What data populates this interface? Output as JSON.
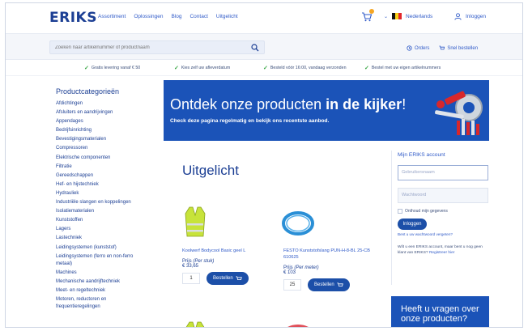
{
  "header": {
    "logo": "ERIKS",
    "nav": [
      "Assortiment",
      "Oplossingen",
      "Blog",
      "Contact",
      "Uitgelicht"
    ],
    "language": "Nederlands",
    "login": "Inloggen"
  },
  "search": {
    "placeholder": "Zoeken naar artikelnummer of productnaam",
    "orders_link": "Orders",
    "quick_order_link": "Snel bestellen"
  },
  "usps": [
    "Gratis levering vanaf € 50",
    "Kies zelf uw afleverdatum",
    "Besteld vóór 16:00, vandaag verzonden",
    "Bestel met uw eigen artikelnummers"
  ],
  "sidebar": {
    "title": "Productcategorieën",
    "items": [
      "Afdichtingen",
      "Afsluiters en aandrijvingen",
      "Appendages",
      "Bedrijfsinrichting",
      "Bevestigingsmaterialen",
      "Compressoren",
      "Elektrische componenten",
      "Filtratie",
      "Gereedschappen",
      "Hef- en hijstechniek",
      "Hydrauliek",
      "Industriële slangen en koppelingen",
      "Isolatiematerialen",
      "Kunststoffen",
      "Lagers",
      "Lastechniek",
      "Leidingsystemen (kunststof)",
      "Leidingsystemen (ferro en non-ferro metaal)",
      "Machines",
      "Mechanische aandrijftechniek",
      "Meet- en regeltechniek",
      "Motoren, reductoren en frequentieregelingen"
    ]
  },
  "banner": {
    "headline_regular": "Ontdek onze producten ",
    "headline_bold": "in de kijker",
    "headline_end": "!",
    "subline": "Check deze pagina regelmatig en bekijk ons recentste aanbod."
  },
  "main": {
    "section_title": "Uitgelicht",
    "products": [
      {
        "name": "Koolwerf Bodycool Basic geel L",
        "price_label": "Prijs",
        "price_unit": "(Per stuk)",
        "price": "€ 33,65",
        "qty": "1",
        "buy_label": "Bestellen"
      },
      {
        "name": "FESTO Kunststofslang PUN-H-8-BL 25-CB 610625",
        "price_label": "Prijs",
        "price_unit": "(Per meter)",
        "price": "€ 103",
        "qty": "25",
        "buy_label": "Bestellen"
      }
    ]
  },
  "account": {
    "title": "Mijn ERIKS account",
    "username_placeholder": "Gebruikersnaam",
    "password_placeholder": "Wachtwoord",
    "remember": "Onthoud mijn gegevens",
    "login_button": "Inloggen",
    "forgot": "Bent u uw wachtwoord vergeten?",
    "note_text": "Wilt u een ERIKS account, maar bent u nog geen klant van ERIKS? ",
    "note_link": "Registreer hier"
  },
  "question_box": {
    "text": "Heeft u vragen over onze producten?"
  },
  "colors": {
    "brand_blue": "#1c3f94",
    "banner_blue": "#1b53b8",
    "link_blue": "#2f5ac8",
    "check_green": "#3aa845"
  }
}
